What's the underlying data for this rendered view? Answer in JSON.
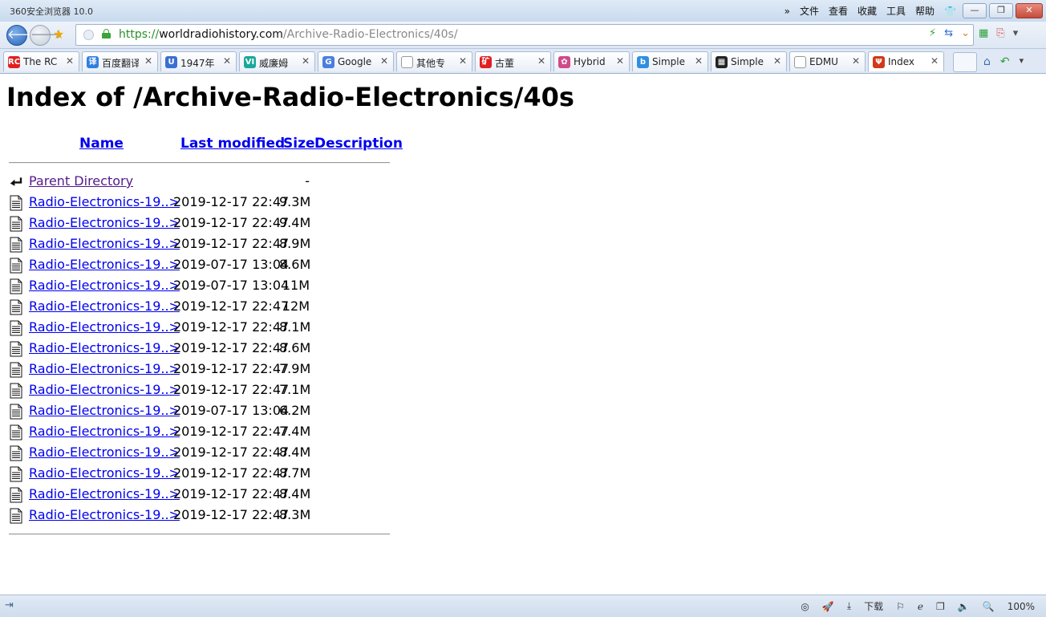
{
  "window": {
    "title": "360安全浏览器 10.0",
    "menu": [
      "»",
      "文件",
      "查看",
      "收藏",
      "工具",
      "帮助"
    ],
    "controls": {
      "minimize": "—",
      "restore": "❐",
      "close": "✕"
    }
  },
  "address_bar": {
    "scheme": "https://",
    "host": "worldradiohistory.com",
    "path": "/Archive-Radio-Electronics/40s/"
  },
  "tabs": [
    {
      "label": "The RC",
      "icon_text": "RC",
      "icon_color": "#e02020"
    },
    {
      "label": "百度翻译",
      "icon_text": "译",
      "icon_color": "#2f7fe0"
    },
    {
      "label": "1947年",
      "icon_text": "U",
      "icon_color": "#3b6fd0"
    },
    {
      "label": "威廉姆",
      "icon_text": "VI",
      "icon_color": "#1aa89a"
    },
    {
      "label": "Google",
      "icon_text": "G",
      "icon_color": "#4a7fe0"
    },
    {
      "label": "其他专",
      "icon_text": "",
      "icon_color": "#ffffff"
    },
    {
      "label": "古董",
      "icon_text": "矿",
      "icon_color": "#e02020"
    },
    {
      "label": "Hybrid",
      "icon_text": "✿",
      "icon_color": "#d04a8a"
    },
    {
      "label": "Simple",
      "icon_text": "b",
      "icon_color": "#2f8fe0"
    },
    {
      "label": "Simple",
      "icon_text": "▦",
      "icon_color": "#222222"
    },
    {
      "label": "EDMU",
      "icon_text": "",
      "icon_color": "#ffffff"
    },
    {
      "label": "Index",
      "icon_text": "Ψ",
      "icon_color": "#d03a1a",
      "active": true
    }
  ],
  "page": {
    "title": "Index of /Archive-Radio-Electronics/40s",
    "columns": {
      "name": "Name",
      "modified": "Last modified",
      "size": "Size",
      "description": "Description"
    },
    "parent": {
      "name": "Parent Directory",
      "size": "-"
    },
    "files": [
      {
        "name": "Radio-Electronics-19..>",
        "modified": "2019-12-17 22:47",
        "size": "9.3M"
      },
      {
        "name": "Radio-Electronics-19..>",
        "modified": "2019-12-17 22:47",
        "size": "9.4M"
      },
      {
        "name": "Radio-Electronics-19..>",
        "modified": "2019-12-17 22:47",
        "size": "8.9M"
      },
      {
        "name": "Radio-Electronics-19..>",
        "modified": "2019-07-17 13:04",
        "size": "8.6M"
      },
      {
        "name": "Radio-Electronics-19..>",
        "modified": "2019-07-17 13:04",
        "size": "11M"
      },
      {
        "name": "Radio-Electronics-19..>",
        "modified": "2019-12-17 22:47",
        "size": "12M"
      },
      {
        "name": "Radio-Electronics-19..>",
        "modified": "2019-12-17 22:47",
        "size": "8.1M"
      },
      {
        "name": "Radio-Electronics-19..>",
        "modified": "2019-12-17 22:47",
        "size": "8.6M"
      },
      {
        "name": "Radio-Electronics-19..>",
        "modified": "2019-12-17 22:47",
        "size": "7.9M"
      },
      {
        "name": "Radio-Electronics-19..>",
        "modified": "2019-12-17 22:47",
        "size": "7.1M"
      },
      {
        "name": "Radio-Electronics-19..>",
        "modified": "2019-07-17 13:04",
        "size": "6.2M"
      },
      {
        "name": "Radio-Electronics-19..>",
        "modified": "2019-12-17 22:47",
        "size": "7.4M"
      },
      {
        "name": "Radio-Electronics-19..>",
        "modified": "2019-12-17 22:47",
        "size": "8.4M"
      },
      {
        "name": "Radio-Electronics-19..>",
        "modified": "2019-12-17 22:47",
        "size": "8.7M"
      },
      {
        "name": "Radio-Electronics-19..>",
        "modified": "2019-12-17 22:47",
        "size": "8.4M"
      },
      {
        "name": "Radio-Electronics-19..>",
        "modified": "2019-12-17 22:47",
        "size": "8.3M"
      }
    ]
  },
  "status_bar": {
    "download_label": "下载",
    "zoom": "100%"
  }
}
